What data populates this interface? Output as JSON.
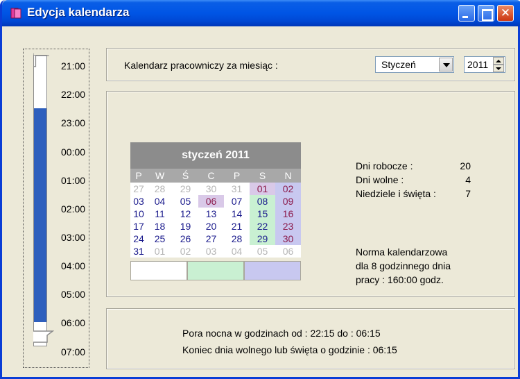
{
  "window": {
    "title": "Edycja kalendarza"
  },
  "colors": {
    "titlebar": "#0055e5",
    "timeline_fill": "#2e5fbd",
    "saturday": "#c9f0d2",
    "sunday": "#c8c8f0",
    "calendar_header": "#8c8c8c"
  },
  "timeline": {
    "labels": [
      "21:00",
      "22:00",
      "23:00",
      "00:00",
      "01:00",
      "02:00",
      "03:00",
      "04:00",
      "05:00",
      "06:00",
      "07:00"
    ]
  },
  "header": {
    "label": "Kalendarz pracowniczy za miesiąc :",
    "month_value": "Styczeń",
    "year_value": "2011"
  },
  "calendar": {
    "title": "styczeń 2011",
    "weekdays": [
      "P",
      "W",
      "Ś",
      "C",
      "P",
      "S",
      "N"
    ],
    "weeks": [
      [
        {
          "d": "27",
          "t": "other"
        },
        {
          "d": "28",
          "t": "other"
        },
        {
          "d": "29",
          "t": "other"
        },
        {
          "d": "30",
          "t": "other"
        },
        {
          "d": "31",
          "t": "other"
        },
        {
          "d": "01",
          "t": "satfree"
        },
        {
          "d": "02",
          "t": "sun"
        }
      ],
      [
        {
          "d": "03",
          "t": ""
        },
        {
          "d": "04",
          "t": ""
        },
        {
          "d": "05",
          "t": ""
        },
        {
          "d": "06",
          "t": "today"
        },
        {
          "d": "07",
          "t": ""
        },
        {
          "d": "08",
          "t": "sat"
        },
        {
          "d": "09",
          "t": "sun"
        }
      ],
      [
        {
          "d": "10",
          "t": ""
        },
        {
          "d": "11",
          "t": ""
        },
        {
          "d": "12",
          "t": ""
        },
        {
          "d": "13",
          "t": ""
        },
        {
          "d": "14",
          "t": ""
        },
        {
          "d": "15",
          "t": "sat"
        },
        {
          "d": "16",
          "t": "sun"
        }
      ],
      [
        {
          "d": "17",
          "t": ""
        },
        {
          "d": "18",
          "t": ""
        },
        {
          "d": "19",
          "t": ""
        },
        {
          "d": "20",
          "t": ""
        },
        {
          "d": "21",
          "t": ""
        },
        {
          "d": "22",
          "t": "sat"
        },
        {
          "d": "23",
          "t": "sun"
        }
      ],
      [
        {
          "d": "24",
          "t": ""
        },
        {
          "d": "25",
          "t": ""
        },
        {
          "d": "26",
          "t": ""
        },
        {
          "d": "27",
          "t": ""
        },
        {
          "d": "28",
          "t": ""
        },
        {
          "d": "29",
          "t": "sat"
        },
        {
          "d": "30",
          "t": "sun"
        }
      ],
      [
        {
          "d": "31",
          "t": ""
        },
        {
          "d": "01",
          "t": "other"
        },
        {
          "d": "02",
          "t": "other"
        },
        {
          "d": "03",
          "t": "other"
        },
        {
          "d": "04",
          "t": "other"
        },
        {
          "d": "05",
          "t": "other"
        },
        {
          "d": "06",
          "t": "other"
        }
      ]
    ]
  },
  "stats": {
    "workdays_label": "Dni robocze :",
    "workdays_value": "20",
    "freedays_label": "Dni wolne :",
    "freedays_value": "4",
    "holidays_label": "Niedziele i święta :",
    "holidays_value": "7"
  },
  "norma": {
    "line1": "Norma  kalendarzowa",
    "line2": "dla 8 godzinnego dnia",
    "line3": "pracy : 160:00   godz."
  },
  "night": {
    "line1": "Pora nocna  w godzinach od :  22:15  do :   06:15",
    "line2": "Koniec dnia wolnego lub święta o godzinie :  06:15"
  }
}
